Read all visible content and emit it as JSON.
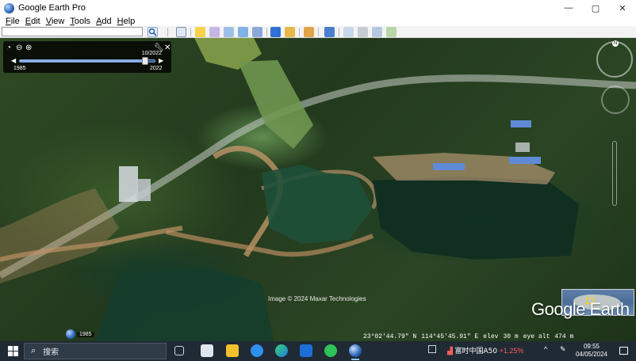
{
  "window": {
    "title": "Google Earth Pro",
    "controls": {
      "minimize": "—",
      "maximize": "▢",
      "close": "✕"
    }
  },
  "menu": [
    {
      "key": "F",
      "rest": "ile"
    },
    {
      "key": "E",
      "rest": "dit"
    },
    {
      "key": "V",
      "rest": "iew"
    },
    {
      "key": "T",
      "rest": "ools"
    },
    {
      "key": "A",
      "rest": "dd"
    },
    {
      "key": "H",
      "rest": "elp"
    }
  ],
  "search": {
    "value": "",
    "placeholder": ""
  },
  "toolbar_icons": [
    "search-icon",
    "sidebar-toggle-icon",
    "placemark-icon",
    "polygon-icon",
    "path-icon",
    "image-overlay-icon",
    "tour-icon",
    "historical-imagery-icon",
    "sun-icon",
    "planets-icon",
    "ruler-icon",
    "email-icon",
    "print-icon",
    "save-image-icon",
    "maps-icon"
  ],
  "colors": {
    "historical_imagery_active": "#2e6fd8",
    "taskbar": "#1f2a34",
    "stock_down": "#ff5b5b"
  },
  "time_slider": {
    "current_date": "10/2022",
    "start_year": "1985",
    "end_year": "2022",
    "position": 0.93
  },
  "map": {
    "credit": "Image © 2024 Maxar Technologies",
    "logo": "Google Earth",
    "imagery_year_badge": "1985",
    "status": {
      "lat": "23°02'44.79\" N",
      "lon": "114°45'45.91\" E",
      "elev_label": "elev",
      "elev_value": "30 m",
      "eye_alt_label": "eye alt",
      "eye_alt_value": "474 m"
    },
    "compass_letter": "N"
  },
  "taskbar": {
    "search_placeholder": "搜索",
    "apps": [
      "task-view-icon",
      "photos-icon",
      "file-explorer-icon",
      "app-blue-icon",
      "edge-icon",
      "outlook-icon",
      "wechat-icon",
      "google-earth-icon"
    ],
    "tray": {
      "stock_name": "富时中国A50",
      "stock_change": "+1.25%",
      "time": "09:55",
      "date": "04/05/2024"
    }
  }
}
